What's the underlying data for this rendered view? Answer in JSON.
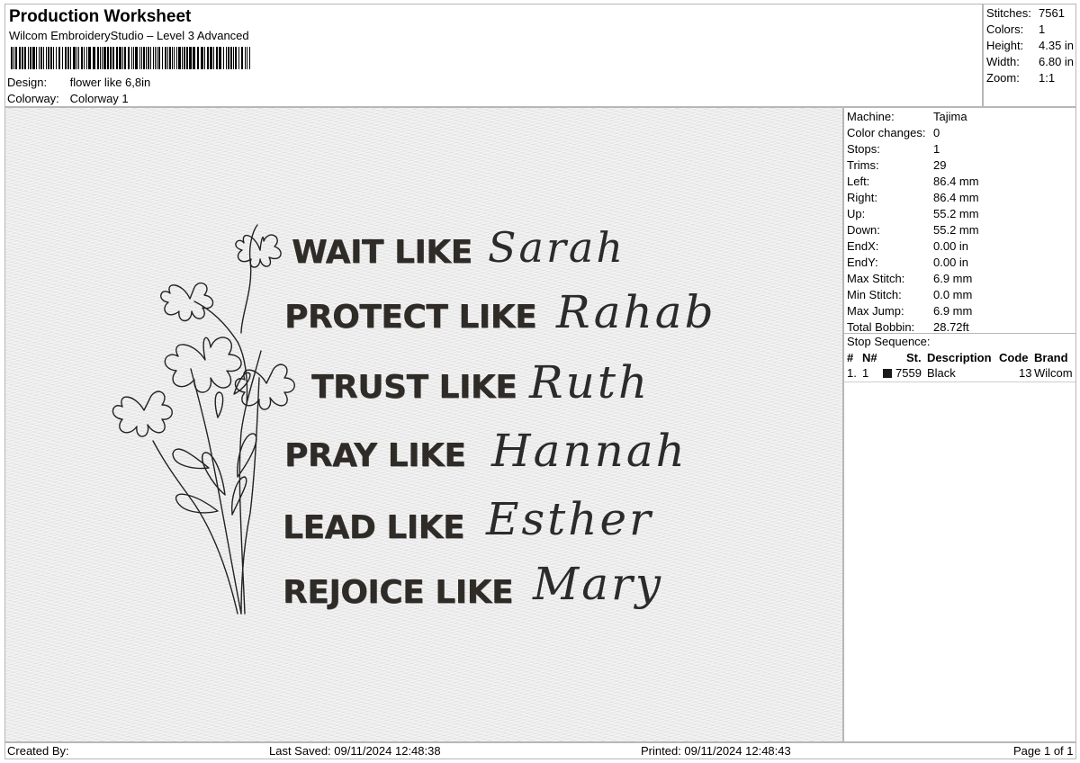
{
  "header": {
    "title": "Production Worksheet",
    "subtitle": "Wilcom EmbroideryStudio – Level 3 Advanced",
    "design_label": "Design:",
    "design_value": "flower like 6,8in",
    "colorway_label": "Colorway:",
    "colorway_value": "Colorway 1"
  },
  "stats": [
    {
      "label": "Stitches:",
      "value": "7561"
    },
    {
      "label": "Colors:",
      "value": "1"
    },
    {
      "label": "Height:",
      "value": "4.35 in"
    },
    {
      "label": "Width:",
      "value": "6.80 in"
    },
    {
      "label": "Zoom:",
      "value": "1:1"
    }
  ],
  "machine": [
    {
      "label": "Machine:",
      "value": "Tajima"
    },
    {
      "label": "Color changes:",
      "value": "0"
    },
    {
      "label": "Stops:",
      "value": "1"
    },
    {
      "label": "Trims:",
      "value": "29"
    },
    {
      "label": "Left:",
      "value": "86.4 mm"
    },
    {
      "label": "Right:",
      "value": "86.4 mm"
    },
    {
      "label": "Up:",
      "value": "55.2 mm"
    },
    {
      "label": "Down:",
      "value": "55.2 mm"
    },
    {
      "label": "EndX:",
      "value": "0.00 in"
    },
    {
      "label": "EndY:",
      "value": "0.00 in"
    },
    {
      "label": "Max Stitch:",
      "value": "6.9 mm"
    },
    {
      "label": "Min Stitch:",
      "value": "0.0 mm"
    },
    {
      "label": "Max Jump:",
      "value": "6.9 mm"
    },
    {
      "label": "Total Bobbin:",
      "value": "28.72ft"
    }
  ],
  "stop_sequence": {
    "title": "Stop Sequence:",
    "columns": {
      "num": "#",
      "n": "N#",
      "st": "St.",
      "description": "Description",
      "code": "Code",
      "brand": "Brand"
    },
    "rows": [
      {
        "num": "1.",
        "n": "1",
        "swatch_color": "#1a1a1a",
        "st": "7559",
        "description": "Black",
        "code": "13",
        "brand": "Wilcom"
      }
    ]
  },
  "design": {
    "lines": [
      {
        "block": "WAIT LIKE",
        "script": "Sarah"
      },
      {
        "block": "PROTECT LIKE",
        "script": "Rahab"
      },
      {
        "block": "TRUST LIKE",
        "script": "Ruth"
      },
      {
        "block": "PRAY LIKE",
        "script": "Hannah"
      },
      {
        "block": "LEAD LIKE",
        "script": "Esther"
      },
      {
        "block": "REJOICE LIKE",
        "script": "Mary"
      }
    ]
  },
  "footer": {
    "created_by": "Created By:",
    "last_saved": "Last Saved: 09/11/2024 12:48:38",
    "printed": "Printed: 09/11/2024 12:48:43",
    "page": "Page 1 of 1"
  }
}
